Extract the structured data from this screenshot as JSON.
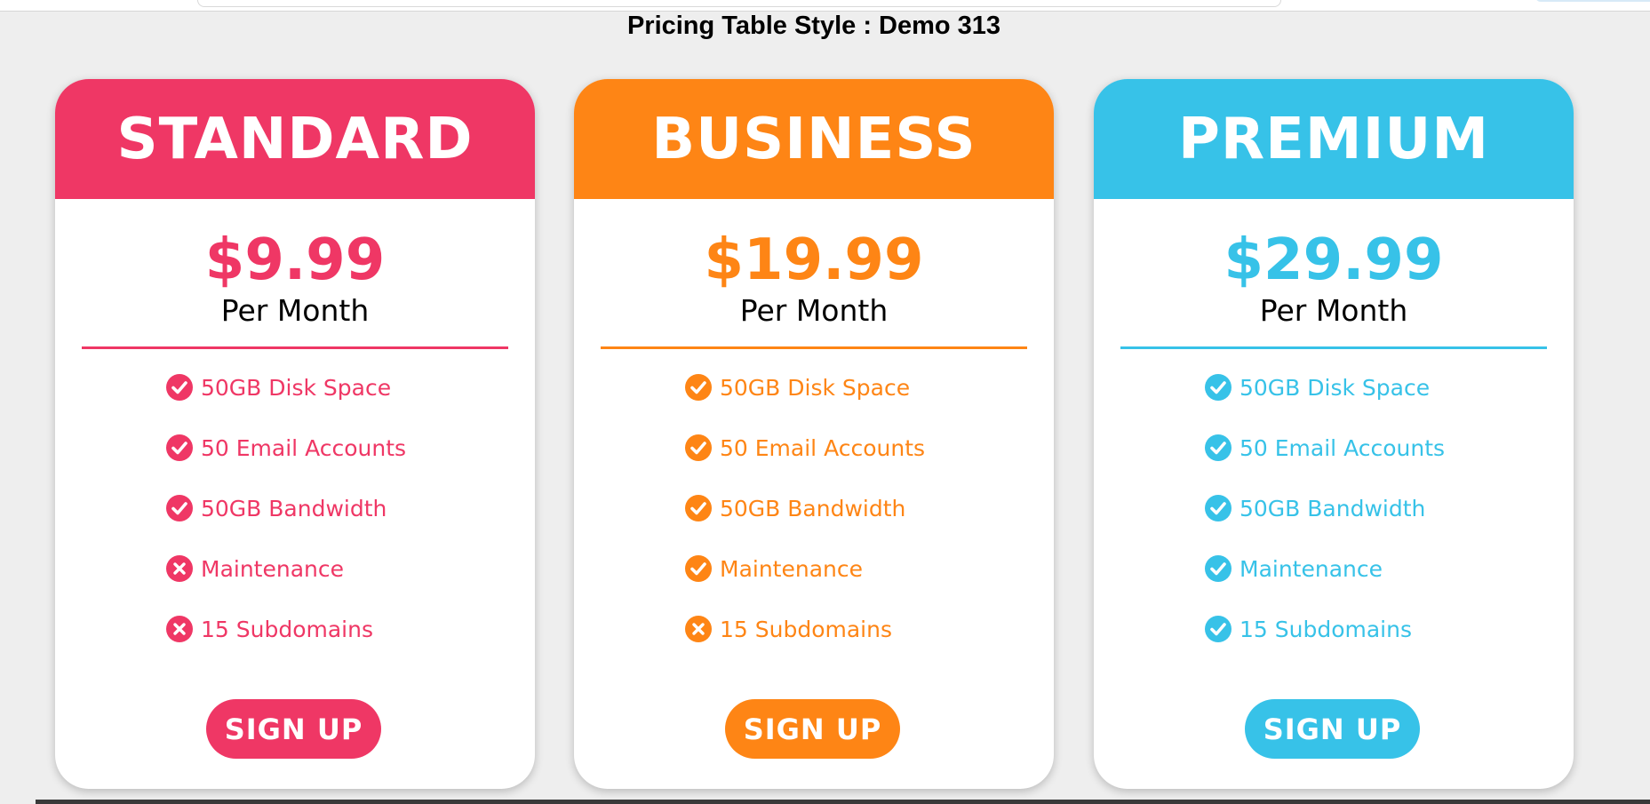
{
  "page": {
    "title": "Pricing Table Style : Demo 313"
  },
  "plans": [
    {
      "name": "STANDARD",
      "price": "$9.99",
      "period": "Per Month",
      "accent": "#ef3765",
      "button_label": "SIGN UP",
      "features": [
        {
          "label": "50GB Disk Space",
          "icon": "check-circle-icon"
        },
        {
          "label": "50 Email Accounts",
          "icon": "check-circle-icon"
        },
        {
          "label": "50GB Bandwidth",
          "icon": "check-circle-icon"
        },
        {
          "label": "Maintenance",
          "icon": "x-circle-icon"
        },
        {
          "label": "15 Subdomains",
          "icon": "x-circle-icon"
        }
      ]
    },
    {
      "name": "BUSINESS",
      "price": "$19.99",
      "period": "Per Month",
      "accent": "#fe8515",
      "button_label": "SIGN UP",
      "features": [
        {
          "label": "50GB Disk Space",
          "icon": "check-circle-icon"
        },
        {
          "label": "50 Email Accounts",
          "icon": "check-circle-icon"
        },
        {
          "label": "50GB Bandwidth",
          "icon": "check-circle-icon"
        },
        {
          "label": "Maintenance",
          "icon": "check-circle-icon"
        },
        {
          "label": "15 Subdomains",
          "icon": "x-circle-icon"
        }
      ]
    },
    {
      "name": "PREMIUM",
      "price": "$29.99",
      "period": "Per Month",
      "accent": "#37c2e8",
      "button_label": "SIGN UP",
      "features": [
        {
          "label": "50GB Disk Space",
          "icon": "check-circle-icon"
        },
        {
          "label": "50 Email Accounts",
          "icon": "check-circle-icon"
        },
        {
          "label": "50GB Bandwidth",
          "icon": "check-circle-icon"
        },
        {
          "label": "Maintenance",
          "icon": "check-circle-icon"
        },
        {
          "label": "15 Subdomains",
          "icon": "check-circle-icon"
        }
      ]
    }
  ]
}
